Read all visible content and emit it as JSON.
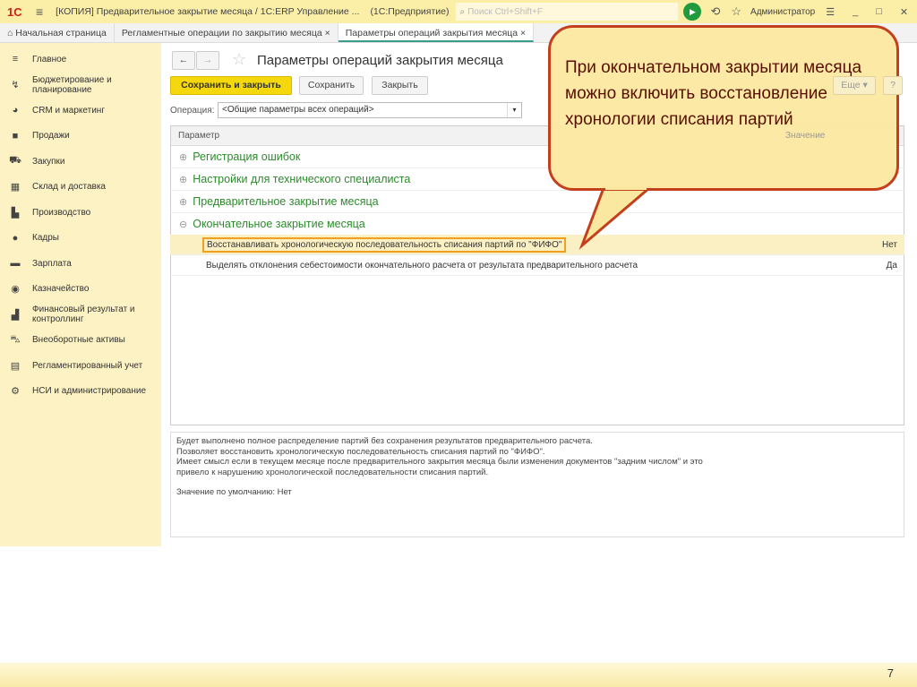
{
  "titlebar": {
    "logo": "1С",
    "title": "[КОПИЯ] Предварительное закрытие месяца / 1С:ERP Управление ...",
    "app": "(1С:Предприятие)",
    "search_placeholder": "Поиск Ctrl+Shift+F",
    "user": "Администратор"
  },
  "tabs": [
    {
      "label": "Начальная страница"
    },
    {
      "label": "Регламентные операции по закрытию месяца"
    },
    {
      "label": "Параметры операций закрытия месяца"
    }
  ],
  "sidebar": {
    "items": [
      {
        "label": "Главное",
        "icon": "menu-icon"
      },
      {
        "label": "Бюджетирование и планирование",
        "icon": "budget-icon"
      },
      {
        "label": "CRM и маркетинг",
        "icon": "crm-icon"
      },
      {
        "label": "Продажи",
        "icon": "bag-icon"
      },
      {
        "label": "Закупки",
        "icon": "cart-icon"
      },
      {
        "label": "Склад и доставка",
        "icon": "warehouse-icon"
      },
      {
        "label": "Производство",
        "icon": "factory-icon"
      },
      {
        "label": "Кадры",
        "icon": "person-icon"
      },
      {
        "label": "Зарплата",
        "icon": "wallet-icon"
      },
      {
        "label": "Казначейство",
        "icon": "coin-icon"
      },
      {
        "label": "Финансовый результат и контроллинг",
        "icon": "chart-icon"
      },
      {
        "label": "Внеоборотные активы",
        "icon": "car-icon"
      },
      {
        "label": "Регламентированный учет",
        "icon": "document-icon"
      },
      {
        "label": "НСИ и администрирование",
        "icon": "gear-icon"
      }
    ]
  },
  "form": {
    "title": "Параметры операций закрытия месяца",
    "save_close": "Сохранить и закрыть",
    "save": "Сохранить",
    "close": "Закрыть",
    "more": "Еще ▾",
    "help": "?",
    "operation_label": "Операция:",
    "operation_value": "<Общие параметры всех операций>"
  },
  "table": {
    "col_param": "Параметр",
    "col_value": "Значение",
    "groups": [
      "Регистрация ошибок",
      "Настройки для технического специалиста",
      "Предварительное закрытие месяца",
      "Окончательное закрытие месяца"
    ],
    "items": [
      {
        "label": "Восстанавливать хронологическую последовательность списания партий по \"ФИФО\"",
        "value": "Нет"
      },
      {
        "label": "Выделять отклонения себестоимости окончательного расчета от результата предварительного расчета",
        "value": "Да"
      }
    ]
  },
  "description": {
    "lines": [
      "Будет выполнено полное распределение партий без сохранения результатов предварительного расчета.",
      "Позволяет восстановить хронологическую последовательность списания партий по \"ФИФО\".",
      "Имеет смысл если в текущем месяце после предварительного закрытия месяца были изменения документов \"задним числом\" и это",
      "привело к нарушению хронологической последовательности списания партий."
    ],
    "default": "Значение по умолчанию: Нет"
  },
  "callout": {
    "text": "При окончательном закрытии месяца можно включить восстановление хронологии списания партий"
  },
  "slide_number": "7"
}
